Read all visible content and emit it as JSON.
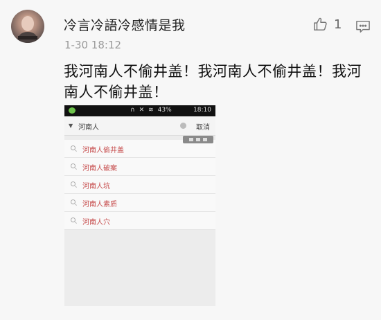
{
  "post": {
    "username": "冷言冷語冷感情是我",
    "timestamp": "1-30 18:12",
    "like_count": "1",
    "text": "我河南人不偷井盖！我河南人不偷井盖！我河南人不偷井盖！"
  },
  "icons": {
    "avatar": "avatar",
    "like": "thumbs-up-icon",
    "comment": "comment-icon"
  },
  "phone": {
    "status_time": "18:10",
    "status_battery": "43%",
    "search_query": "河南人",
    "cancel_label": "取消",
    "suggestions": [
      "河南人偷井盖",
      "河南人破案",
      "河南人坑",
      "河南人素质",
      "河南人穴"
    ]
  },
  "colors": {
    "background": "#f7f7f7",
    "text": "#111111",
    "muted": "#9a9a9a",
    "suggestion_text": "#c64b4b"
  }
}
